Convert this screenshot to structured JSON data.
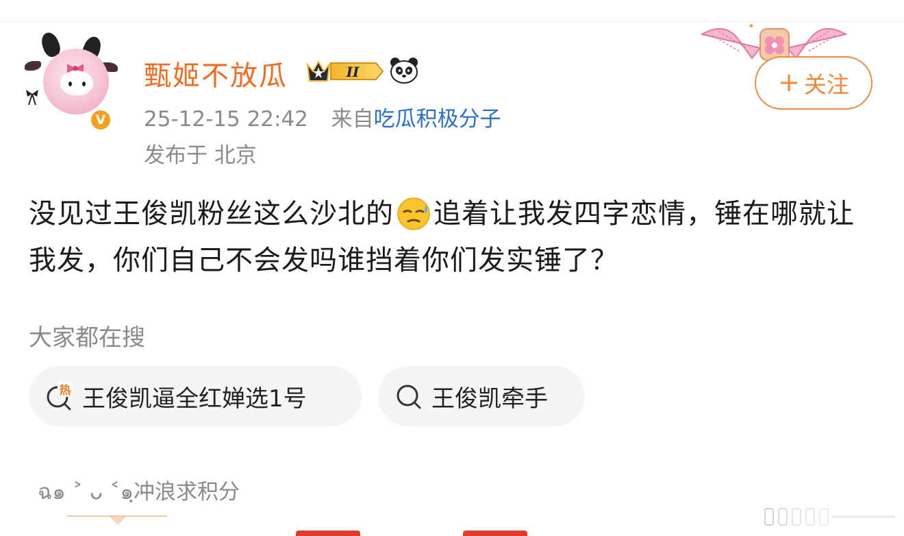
{
  "post": {
    "author": {
      "name": "甄姬不放瓜",
      "level_badge": "II",
      "verified_mark": "V",
      "avatar_icon": "hello-kitty-avatar",
      "badge_icon": "crown-level-icon",
      "extra_icon": "panda-icon"
    },
    "timestamp": "25-12-15 22:42",
    "source_prefix": "来自",
    "source": "吃瓜积极分子",
    "location": "发布于 北京",
    "follow_label": "关注",
    "text_before_emoji": "没见过王俊凯粉丝这么沙北的",
    "emoji": "sweat-emoji",
    "text_after_emoji": "追着让我发四字恋情，锤在哪就让我发，你们自己不会发吗谁挡着你们发实锤了？"
  },
  "search": {
    "title": "大家都在搜",
    "items": [
      {
        "label": "王俊凯逼全红婵选1号",
        "icon": "hot-search-icon",
        "hot_tag": "热"
      },
      {
        "label": "王俊凯牵手",
        "icon": "search-icon"
      }
    ]
  },
  "supertopic": {
    "text": "ฉ๑ ˃ ᴗ ˂๑ฺ冲浪求积分"
  },
  "colors": {
    "accent_orange": "#f26c20",
    "follow_orange": "#f08a3a",
    "link_blue": "#2a6fc9",
    "meta_gray": "#8a8a8a",
    "chip_bg": "#f5f5f5"
  }
}
